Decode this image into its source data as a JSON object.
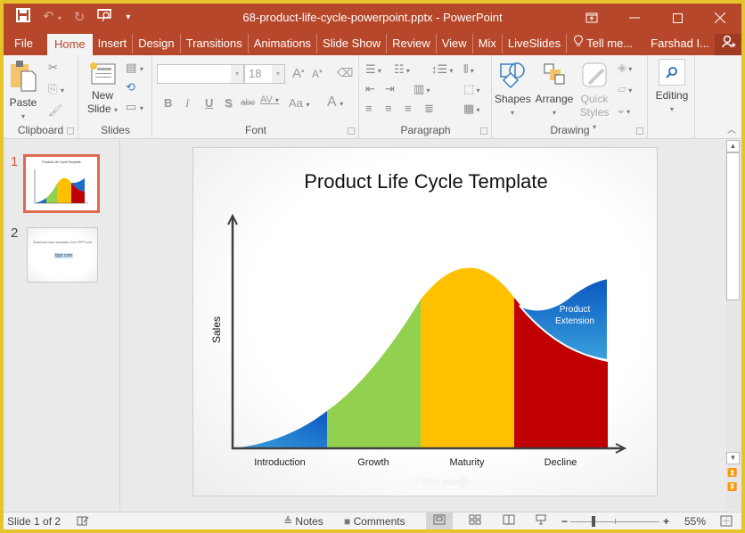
{
  "window": {
    "title": "68-product-life-cycle-powerpoint.pptx - PowerPoint",
    "controls": {
      "ribbon_display": "⬒",
      "minimize": "—",
      "maximize": "☐",
      "close": "✕"
    }
  },
  "qat": {
    "save": "💾",
    "undo": "↶",
    "redo": "↻",
    "start_from_beginning": "⎚",
    "customize": "⌄"
  },
  "tabs": [
    {
      "label": "File"
    },
    {
      "label": "Home"
    },
    {
      "label": "Insert"
    },
    {
      "label": "Design"
    },
    {
      "label": "Transitions"
    },
    {
      "label": "Animations"
    },
    {
      "label": "Slide Show"
    },
    {
      "label": "Review"
    },
    {
      "label": "View"
    },
    {
      "label": "Mix"
    },
    {
      "label": "LiveSlides"
    }
  ],
  "active_tab": "Home",
  "tell_me": "Tell me...",
  "user": "Farshad I...",
  "share": "Share",
  "ribbon": {
    "clipboard": {
      "label": "Clipboard",
      "paste": "Paste"
    },
    "slides": {
      "label": "Slides",
      "new_slide_1": "New",
      "new_slide_2": "Slide"
    },
    "font": {
      "label": "Font",
      "font_name": "",
      "font_size": "18",
      "bold": "B",
      "italic": "I",
      "underline": "U",
      "shadow": "S",
      "strike": "abc",
      "spacing": "AV",
      "case": "Aa",
      "color": "A",
      "grow": "A",
      "shrink": "A"
    },
    "paragraph": {
      "label": "Paragraph"
    },
    "drawing": {
      "label": "Drawing",
      "shapes": "Shapes",
      "arrange": "Arrange",
      "quick_styles_1": "Quick",
      "quick_styles_2": "Styles"
    },
    "editing": {
      "label": "Editing"
    }
  },
  "thumbnails": [
    {
      "number": "1",
      "title": "Product Life Cycle Template",
      "selected": true
    },
    {
      "number": "2",
      "text": "Download more templates from FPPT.com",
      "brand": "fppt.com",
      "selected": false
    }
  ],
  "slide": {
    "title": "Product Life Cycle Template",
    "y_axis_label": "Sales",
    "x_watermark": "TIME",
    "extension_label_1": "Product",
    "extension_label_2": "Extension",
    "stages": [
      {
        "name": "Introduction",
        "color": "#0b63c4"
      },
      {
        "name": "Growth",
        "color": "#92d050"
      },
      {
        "name": "Maturity",
        "color": "#ffc000"
      },
      {
        "name": "Decline",
        "color": "#c00000"
      }
    ]
  },
  "status": {
    "slide_counter": "Slide 1 of 2",
    "notes": "Notes",
    "comments": "Comments",
    "zoom": "55%",
    "zoom_minus": "−",
    "zoom_plus": "+"
  }
}
